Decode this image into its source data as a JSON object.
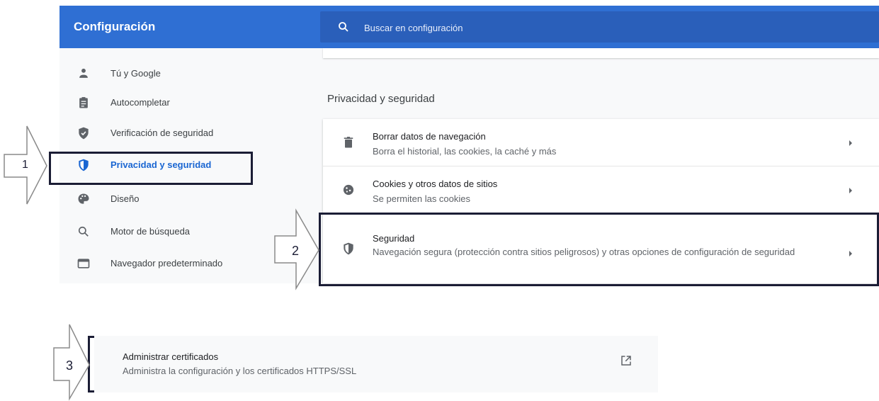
{
  "app": {
    "title": "Configuración"
  },
  "search": {
    "placeholder": "Buscar en configuración"
  },
  "colors": {
    "header": "#2f6fd3",
    "accent": "#1a66d2",
    "highlight_border": "#1b1d35"
  },
  "sidebar": {
    "items": [
      {
        "label": "Tú y Google",
        "icon": "person-icon"
      },
      {
        "label": "Autocompletar",
        "icon": "clipboard-icon"
      },
      {
        "label": "Verificación de seguridad",
        "icon": "shield-check-icon"
      },
      {
        "label": "Privacidad y seguridad",
        "icon": "privacy-shield-icon",
        "active": true
      },
      {
        "label": "Diseño",
        "icon": "palette-icon"
      },
      {
        "label": "Motor de búsqueda",
        "icon": "search-icon"
      },
      {
        "label": "Navegador predeterminado",
        "icon": "browser-window-icon"
      }
    ]
  },
  "main": {
    "section_title": "Privacidad y seguridad",
    "rows": [
      {
        "title": "Borrar datos de navegación",
        "subtitle": "Borra el historial, las cookies, la caché y más",
        "icon": "trash-icon"
      },
      {
        "title": "Cookies y otros datos de sitios",
        "subtitle": "Se permiten las cookies",
        "icon": "cookie-icon"
      },
      {
        "title": "Seguridad",
        "subtitle": "Navegación segura (protección contra sitios peligrosos) y otras opciones de configuración de seguridad",
        "icon": "security-shield-icon"
      }
    ]
  },
  "certificates": {
    "title": "Administrar certificados",
    "subtitle": "Administra la configuración y los certificados HTTPS/SSL",
    "icon": "open-external-icon"
  },
  "callouts": [
    "1",
    "2",
    "3"
  ]
}
